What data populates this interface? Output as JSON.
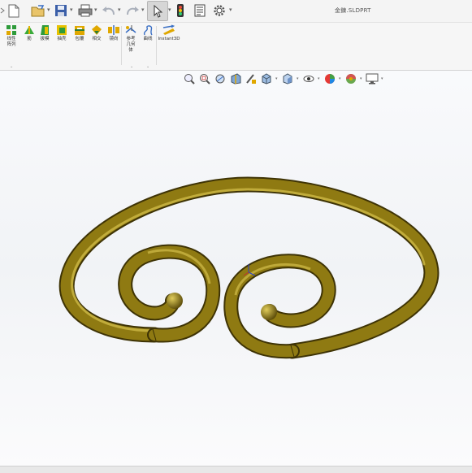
{
  "window": {
    "document_title": "金鍊.SLDPRT"
  },
  "quick_access": {
    "icons": [
      "new-document-icon",
      "open-icon",
      "save-icon",
      "print-icon",
      "undo-icon",
      "redo-icon",
      "select-arrow-icon",
      "rebuild-icon",
      "file-properties-icon",
      "options-gear-icon"
    ]
  },
  "ribbon": {
    "tools": [
      {
        "label_line1": "线性",
        "label_line2": "阵列",
        "icon": "linear-pattern-icon"
      },
      {
        "label_line1": "筋",
        "label_line2": "",
        "icon": "rib-icon"
      },
      {
        "label_line1": "拔模",
        "label_line2": "",
        "icon": "draft-icon"
      },
      {
        "label_line1": "抽壳",
        "label_line2": "",
        "icon": "shell-icon"
      },
      {
        "label_line1": "包覆",
        "label_line2": "",
        "icon": "wrap-icon"
      },
      {
        "label_line1": "相交",
        "label_line2": "",
        "icon": "intersect-icon"
      },
      {
        "label_line1": "镜向",
        "label_line2": "",
        "icon": "mirror-icon"
      },
      {
        "label_line1": "参考",
        "label_line2": "几何",
        "label_line3": "体",
        "icon": "reference-geometry-icon"
      },
      {
        "label_line1": "曲线",
        "label_line2": "",
        "icon": "curves-icon"
      },
      {
        "label_line1": "Instant3D",
        "label_line2": "",
        "icon": "instant3d-icon"
      }
    ]
  },
  "heads_up_toolbar": {
    "icons": [
      "zoom-to-fit-icon",
      "zoom-to-area-icon",
      "previous-view-icon",
      "section-view-icon",
      "dynamic-annotation-icon",
      "view-orientation-icon",
      "display-style-icon",
      "hide-show-items-icon",
      "edit-appearance-icon",
      "apply-scene-icon",
      "view-settings-icon"
    ]
  },
  "model": {
    "name": "gold spiral bangle",
    "color": "#8f7a12"
  }
}
